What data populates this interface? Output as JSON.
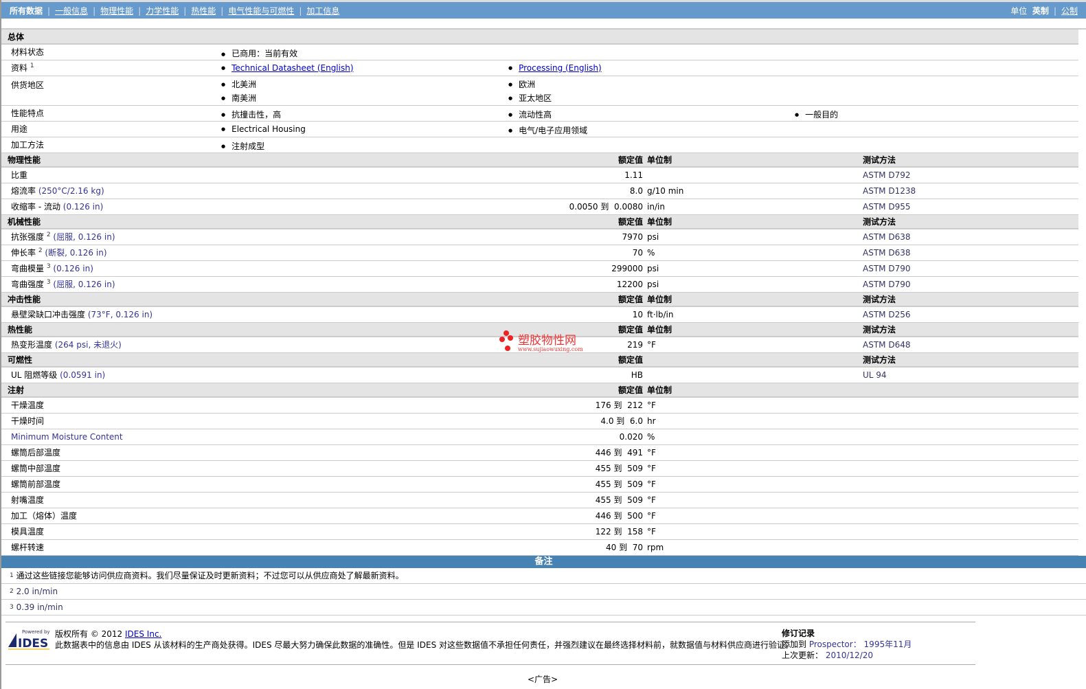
{
  "nav": {
    "items": [
      "所有数据",
      "一般信息",
      "物理性能",
      "力学性能",
      "热性能",
      "电气性能与可燃性",
      "加工信息"
    ],
    "units_label": "单位",
    "unit_english": "英制",
    "unit_metric": "公制"
  },
  "general": {
    "title": "总体",
    "rows": [
      {
        "label": "材料状态",
        "items": [
          "已商用：当前有效"
        ]
      },
      {
        "label": "资料",
        "sup": "1",
        "links": [
          "Technical Datasheet (English)",
          "Processing (English)"
        ]
      },
      {
        "label": "供货地区",
        "items": [
          "北美洲",
          "欧洲",
          "南美洲",
          "亚太地区"
        ]
      },
      {
        "label": "性能特点",
        "items": [
          "抗撞击性，高",
          "流动性高",
          "一般目的"
        ]
      },
      {
        "label": "用途",
        "items": [
          "Electrical Housing",
          "电气/电子应用领域"
        ]
      },
      {
        "label": "加工方法",
        "items": [
          "注射成型"
        ]
      }
    ]
  },
  "headers": {
    "nominal": "额定值",
    "unit": "单位制",
    "method": "测试方法"
  },
  "sections": [
    {
      "title": "物理性能",
      "unit": true,
      "method": true,
      "rows": [
        {
          "label": "比重",
          "cond": "",
          "value": "1.11",
          "unit": "",
          "method": "ASTM D792"
        },
        {
          "label": "熔流率",
          "cond": "(250°C/2.16 kg)",
          "value": "8.0",
          "unit": "g/10 min",
          "method": "ASTM D1238"
        },
        {
          "label": "收缩率 - 流动",
          "cond": "(0.126 in)",
          "value": "0.0050 到  0.0080",
          "unit": "in/in",
          "method": "ASTM D955"
        }
      ]
    },
    {
      "title": "机械性能",
      "unit": true,
      "method": true,
      "rows": [
        {
          "label": "抗张强度",
          "sup": "2",
          "cond": "(屈服, 0.126 in)",
          "value": "7970",
          "unit": "psi",
          "method": "ASTM D638"
        },
        {
          "label": "伸长率",
          "sup": "2",
          "cond": "(断裂, 0.126 in)",
          "value": "70",
          "unit": "%",
          "method": "ASTM D638"
        },
        {
          "label": "弯曲模量",
          "sup": "3",
          "cond": "(0.126 in)",
          "value": "299000",
          "unit": "psi",
          "method": "ASTM D790"
        },
        {
          "label": "弯曲强度",
          "sup": "3",
          "cond": "(屈服, 0.126 in)",
          "value": "12200",
          "unit": "psi",
          "method": "ASTM D790"
        }
      ]
    },
    {
      "title": "冲击性能",
      "unit": true,
      "method": true,
      "rows": [
        {
          "label": "悬壁梁缺口冲击强度",
          "cond": "(73°F, 0.126 in)",
          "value": "10",
          "unit": "ft·lb/in",
          "method": "ASTM D256"
        }
      ]
    },
    {
      "title": "热性能",
      "unit": true,
      "method": true,
      "rows": [
        {
          "label": "热变形温度",
          "cond": "(264 psi, 未退火)",
          "value": "219",
          "unit": "°F",
          "method": "ASTM D648"
        }
      ]
    },
    {
      "title": "可燃性",
      "unit": false,
      "method": true,
      "rows": [
        {
          "label": "UL 阻燃等级",
          "cond": "(0.0591 in)",
          "value": "HB",
          "unit": "",
          "method": "UL 94"
        }
      ]
    },
    {
      "title": "注射",
      "unit": true,
      "method": false,
      "rows": [
        {
          "label": "干燥温度",
          "cond": "",
          "value": "176 到  212",
          "unit": "°F",
          "method": ""
        },
        {
          "label": "干燥时间",
          "cond": "",
          "value": "4.0 到  6.0",
          "unit": "hr",
          "method": ""
        },
        {
          "label": "",
          "cond": "Minimum Moisture Content",
          "value": "0.020",
          "unit": "%",
          "method": ""
        },
        {
          "label": "螺筒后部温度",
          "cond": "",
          "value": "446 到  491",
          "unit": "°F",
          "method": ""
        },
        {
          "label": "螺筒中部温度",
          "cond": "",
          "value": "455 到  509",
          "unit": "°F",
          "method": ""
        },
        {
          "label": "螺筒前部温度",
          "cond": "",
          "value": "455 到  509",
          "unit": "°F",
          "method": ""
        },
        {
          "label": "射嘴温度",
          "cond": "",
          "value": "455 到  509",
          "unit": "°F",
          "method": ""
        },
        {
          "label": "加工（熔体）温度",
          "cond": "",
          "value": "446 到  500",
          "unit": "°F",
          "method": ""
        },
        {
          "label": "模具温度",
          "cond": "",
          "value": "122 到  158",
          "unit": "°F",
          "method": ""
        },
        {
          "label": "螺杆转速",
          "cond": "",
          "value": "40 到  70",
          "unit": "rpm",
          "method": ""
        }
      ]
    }
  ],
  "notes": {
    "title": "备注",
    "items": [
      {
        "n": "1",
        "text": "通过这些链接您能够访问供应商资料。我们尽量保证及时更新资料；不过您可以从供应商处了解最新资料。"
      },
      {
        "n": "2",
        "text": "2.0 in/min"
      },
      {
        "n": "3",
        "text": "0.39 in/min"
      }
    ]
  },
  "footer": {
    "logo_text": "Powered by IDES",
    "copyright": "版权所有  © 2012",
    "company_link": "IDES Inc.",
    "disclaimer": "此数据表中的信息由 IDES 从该材料的生产商处获得。IDES 尽最大努力确保此数据的准确性。但是 IDES 对这些数据值不承担任何责任，并强烈建议在最终选择材料前，就数据值与材料供应商进行验证。",
    "revision_title": "修订记录",
    "added_label": "添加到",
    "added_prospector": "Prospector：",
    "added_date": "1995年11月",
    "updated_label": "上次更新：",
    "updated_date": "2010/12/20"
  },
  "ad": "<广告>",
  "watermark": {
    "text": "塑胶物性网",
    "url": "www.sujiaowuxing.com"
  },
  "colors": {
    "nav": "#6699cc",
    "notes_bar": "#4682b4",
    "section": "#e4e4e4"
  }
}
